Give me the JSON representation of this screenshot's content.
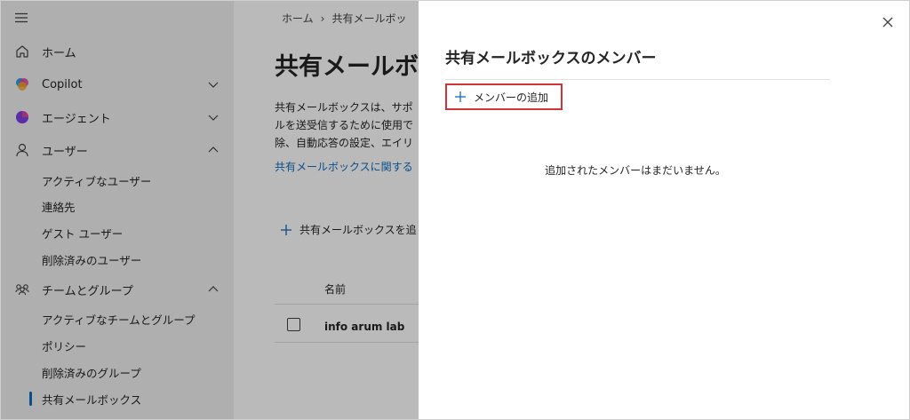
{
  "sidebar": {
    "items": [
      {
        "label": "ホーム",
        "icon": "home-icon"
      },
      {
        "label": "Copilot",
        "icon": "copilot-icon",
        "expanded": false
      },
      {
        "label": "エージェント",
        "icon": "agent-icon",
        "expanded": false
      },
      {
        "label": "ユーザー",
        "icon": "user-icon",
        "expanded": true
      },
      {
        "label": "チームとグループ",
        "icon": "teams-icon",
        "expanded": true
      }
    ],
    "users_sub": [
      "アクティブなユーザー",
      "連絡先",
      "ゲスト ユーザー",
      "削除済みのユーザー"
    ],
    "teams_sub": [
      "アクティブなチームとグループ",
      "ポリシー",
      "削除済みのグループ",
      "共有メールボックス"
    ],
    "selected": "共有メールボックス"
  },
  "main": {
    "breadcrumb": [
      "ホーム",
      "共有メールボッ"
    ],
    "title": "共有メールボッ",
    "description_lines": [
      "共有メールボックスは、サポ",
      "ルを送受信するために使用で",
      "除、自動応答の設定、エイリ"
    ],
    "link": "共有メールボックスに関する",
    "add_button": "共有メールボックスを追",
    "table": {
      "column_name": "名前",
      "rows": [
        {
          "name": "info arum lab"
        }
      ]
    }
  },
  "panel": {
    "title": "共有メールボックスのメンバー",
    "add_member": "メンバーの追加",
    "empty_message": "追加されたメンバーはまだいません。"
  },
  "colors": {
    "accent": "#0f6cbd",
    "highlight_border": "#d13438",
    "sidebar_bg": "#f0f0f0"
  }
}
